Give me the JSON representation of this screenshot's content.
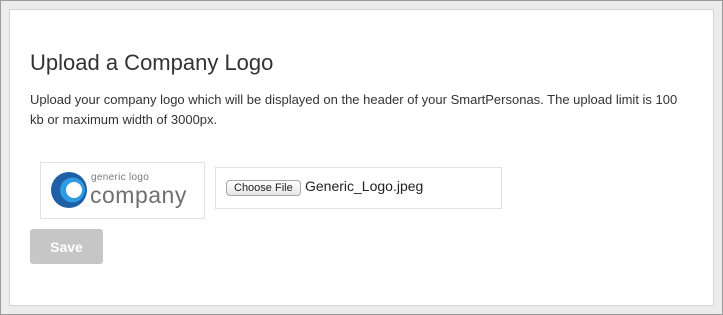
{
  "page": {
    "title": "Upload a Company Logo",
    "description": "Upload your company logo which will be displayed on the header of your SmartPersonas. The upload limit is 100 kb or maximum width of 3000px."
  },
  "logo_preview": {
    "small_text": "generic logo",
    "big_text": "company",
    "colors": {
      "mark_dark": "#1f5fa6",
      "mark_light": "#2f9be0",
      "text": "#6f6f6f"
    }
  },
  "file_input": {
    "button_label": "Choose File",
    "file_name": "Generic_Logo.jpeg"
  },
  "actions": {
    "save_label": "Save",
    "save_color": "#c6c6c6"
  }
}
